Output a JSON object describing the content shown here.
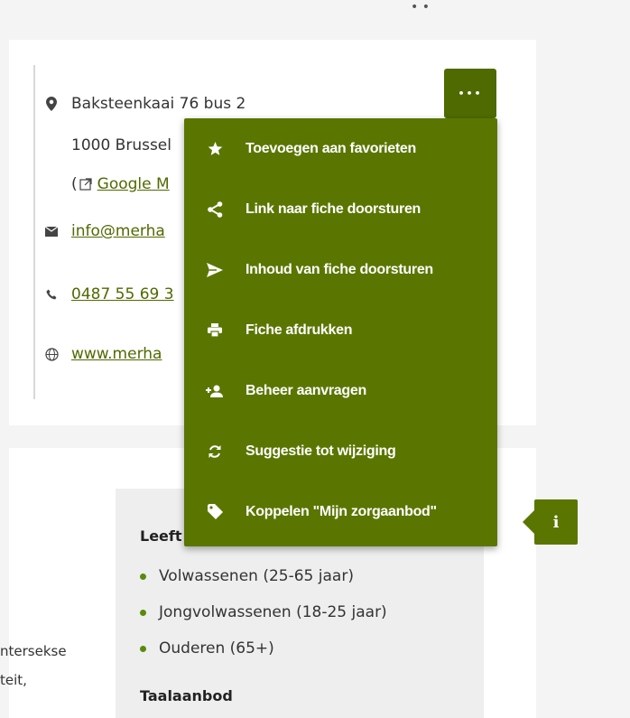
{
  "top": {
    "glyphs": "•  •"
  },
  "address": {
    "line1": "Baksteenkaai 76 bus 2",
    "line2": "1000 Brussel",
    "map_prefix": "(",
    "map_link": "Google M",
    "email": "info@merha",
    "phone": "0487 55 69 3",
    "website": "www.merha"
  },
  "actions": {
    "more_label": "•••",
    "menu": [
      {
        "icon": "star-icon",
        "label": "Toevoegen aan favorieten"
      },
      {
        "icon": "share-icon",
        "label": "Link naar fiche doorsturen"
      },
      {
        "icon": "send-icon",
        "label": "Inhoud van fiche doorsturen"
      },
      {
        "icon": "print-icon",
        "label": "Fiche afdrukken"
      },
      {
        "icon": "add-user-icon",
        "label": "Beheer aanvragen"
      },
      {
        "icon": "refresh-icon",
        "label": "Suggestie tot wijziging"
      },
      {
        "icon": "tag-icon",
        "label": "Koppelen \"Mijn zorgaanbod\""
      }
    ],
    "info_label": "i"
  },
  "details": {
    "age_heading": "Leeft",
    "age_items": [
      "Volwassenen (25-65 jaar)",
      "Jongvolwassenen (18-25 jaar)",
      "Ouderen (65+)"
    ],
    "language_heading": "Taalaanbod",
    "side_text": [
      "ntersekse",
      "teit,"
    ]
  },
  "colors": {
    "accent": "#5a7600",
    "link": "#4f6a00",
    "bullet": "#5a8a0a"
  }
}
